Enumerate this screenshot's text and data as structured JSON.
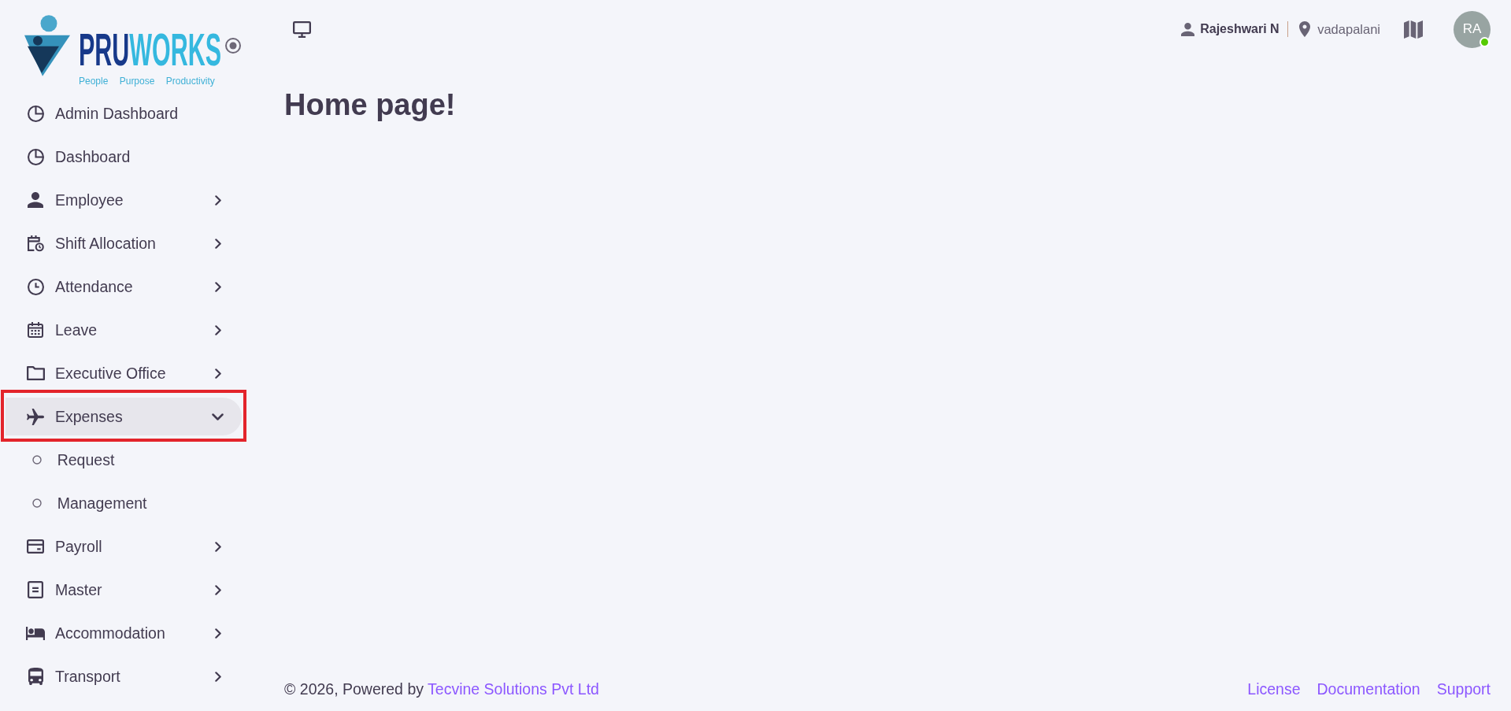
{
  "sidebar": {
    "logo": {
      "wordmark_part_1": "PRU",
      "wordmark_part_2": "WORKS",
      "tagline": "People Purpose Productivity"
    },
    "menu": [
      {
        "label": "Admin Dashboard",
        "selected": false,
        "highlighted": false
      },
      {
        "label": "Dashboard",
        "selected": false,
        "highlighted": false
      },
      {
        "label": "Employee",
        "selected": false,
        "expanded": false,
        "highlighted": false
      },
      {
        "label": "Shift Allocation",
        "selected": false,
        "expanded": false,
        "highlighted": false
      },
      {
        "label": "Attendance",
        "selected": false,
        "expanded": false,
        "highlighted": false
      },
      {
        "label": "Leave",
        "selected": false,
        "expanded": false,
        "highlighted": false
      },
      {
        "label": "Executive Office",
        "selected": false,
        "expanded": false,
        "highlighted": false
      },
      {
        "label": "Expenses",
        "selected": false,
        "expanded": true,
        "highlighted": true,
        "children": [
          {
            "label": "Request",
            "selected": false
          },
          {
            "label": "Management",
            "selected": false
          }
        ]
      },
      {
        "label": "Payroll",
        "selected": false,
        "expanded": false,
        "highlighted": false
      },
      {
        "label": "Master",
        "selected": false,
        "expanded": false,
        "highlighted": false
      },
      {
        "label": "Accommodation",
        "selected": false,
        "expanded": false,
        "highlighted": false
      },
      {
        "label": "Transport",
        "selected": false,
        "expanded": false,
        "highlighted": false
      }
    ]
  },
  "header": {
    "user_name": "Rajeshwari N",
    "location": "vadapalani",
    "avatar_initials": "RA",
    "online": true
  },
  "page": {
    "title": "Home page!"
  },
  "footer": {
    "copyright": "© 2026, Powered by",
    "company": "Tecvine Solutions Pvt Ltd",
    "links": [
      "License",
      "Documentation",
      "Support"
    ]
  }
}
